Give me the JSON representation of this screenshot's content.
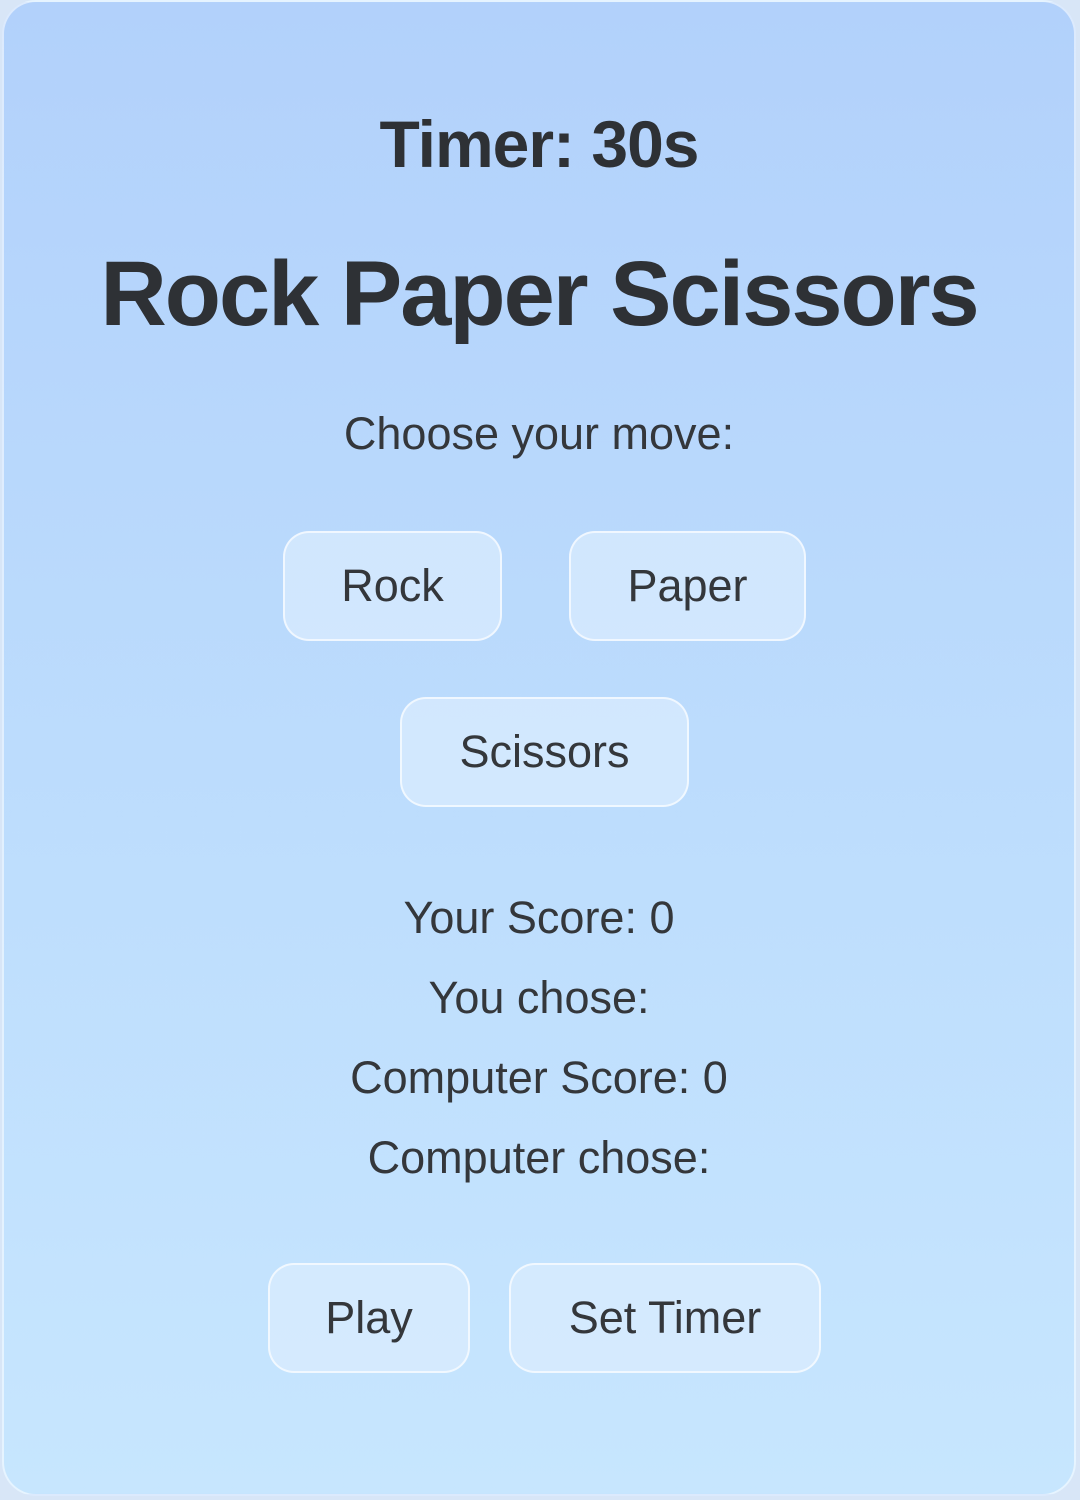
{
  "game": {
    "timer_text": "Timer: 30s",
    "title": "Rock Paper Scissors",
    "prompt": "Choose your move:",
    "moves": {
      "rock": "Rock",
      "paper": "Paper",
      "scissors": "Scissors"
    },
    "stats": {
      "your_score": "Your Score: 0",
      "you_chose": "You chose:",
      "computer_score": "Computer Score: 0",
      "computer_chose": "Computer chose:"
    },
    "actions": {
      "play": "Play",
      "set_timer": "Set Timer"
    }
  },
  "colors": {
    "background_top": "#b2d1fb",
    "background_bottom": "#c7e6fe",
    "button_fill": "#dcecfd",
    "text": "#2f3236"
  }
}
